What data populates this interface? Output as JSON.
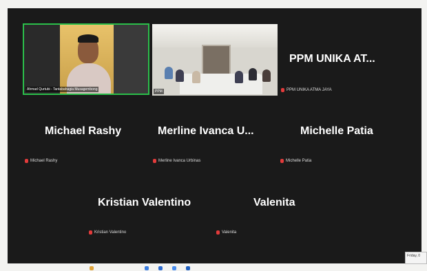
{
  "tiles": [
    {
      "name_tag": "Ahmad Qurtubi - Tantabahagia Musagembong"
    },
    {
      "name_tag": "PPM"
    }
  ],
  "participants": [
    {
      "display_name": "PPM UNIKA AT...",
      "label": "PPM UNIKA ATMA JAYA"
    },
    {
      "display_name": "Michael Rashy",
      "label": "Michael Rashy"
    },
    {
      "display_name": "Merline Ivanca U...",
      "label": "Merline Ivanca Urbinas"
    },
    {
      "display_name": "Michelle Patia",
      "label": "Michelle Patia"
    },
    {
      "display_name": "Kristian Valentino",
      "label": "Kristian Valentino"
    },
    {
      "display_name": "Valenita",
      "label": "Valenita"
    }
  ],
  "clock": {
    "text": "Friday, 0"
  },
  "colors": {
    "active_speaker_border": "#2bbf4a",
    "muted_mic": "#e23b3b",
    "background": "#1a1a1a"
  }
}
